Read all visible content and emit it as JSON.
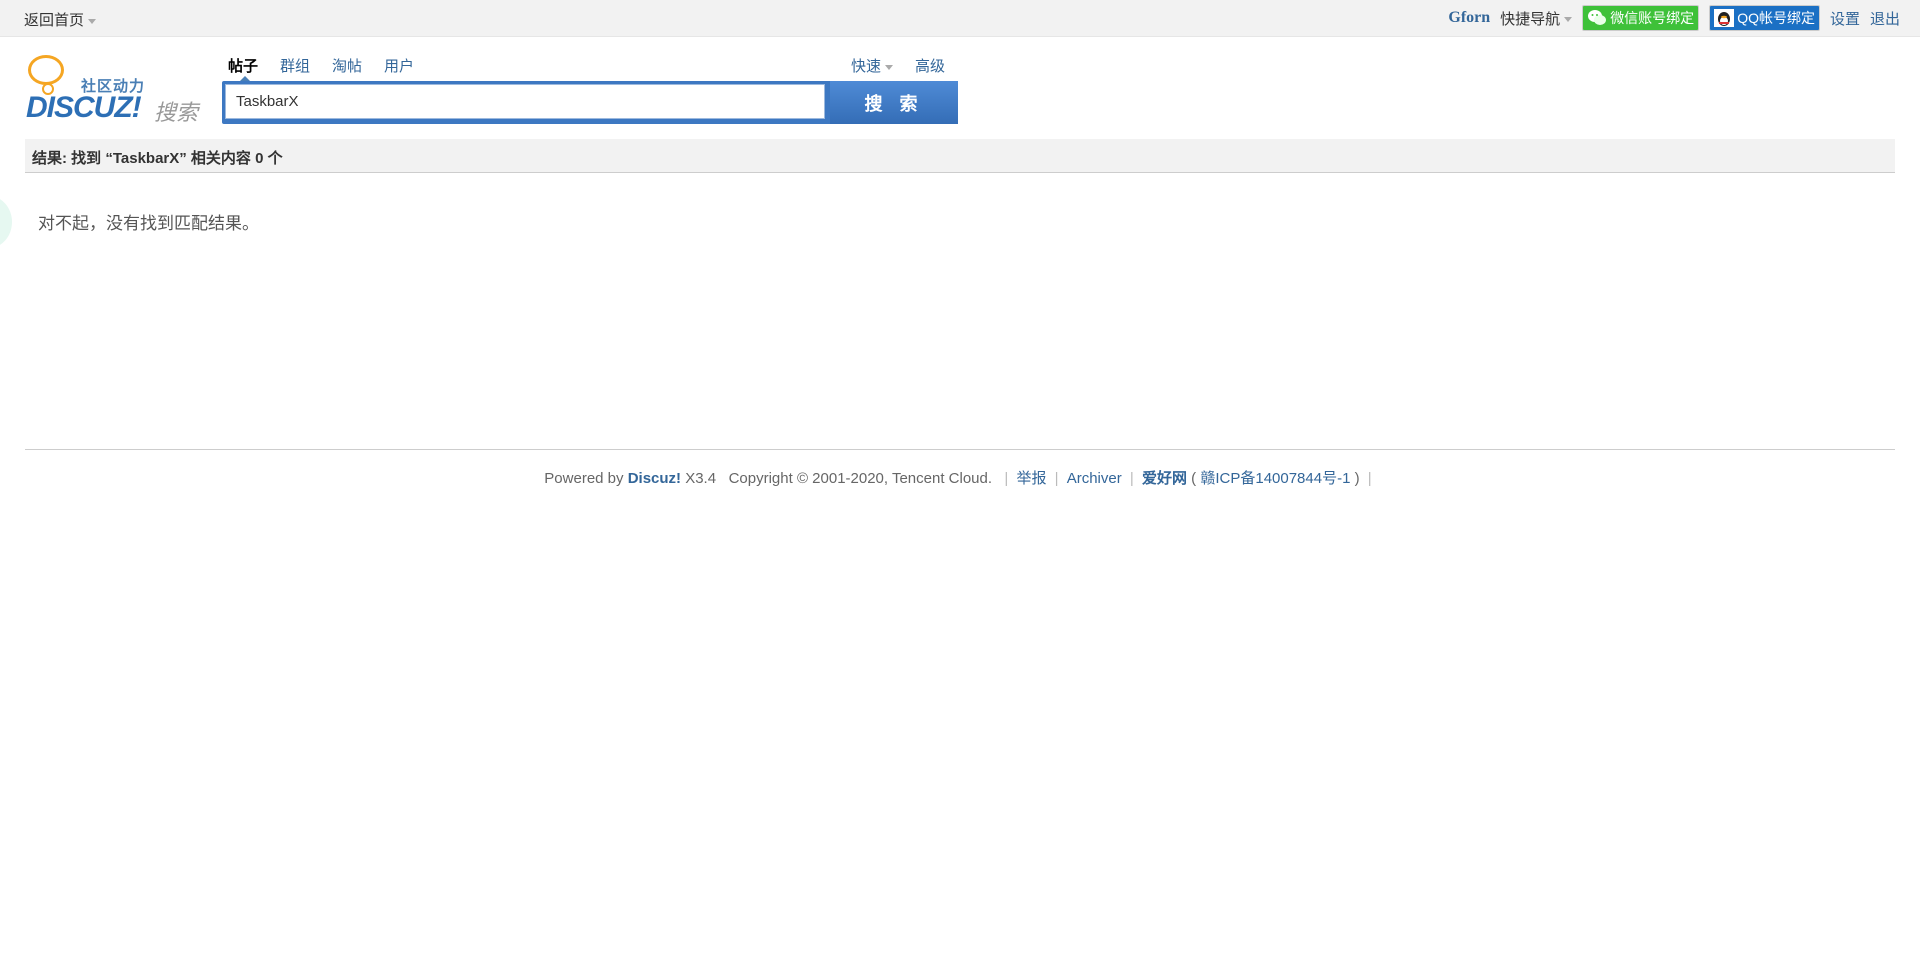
{
  "topbar": {
    "home": "返回首页",
    "username": "Gforn",
    "quick_nav": "快捷导航",
    "wechat_bind": "微信账号绑定",
    "qq_bind": "QQ帐号绑定",
    "settings": "设置",
    "logout": "退出"
  },
  "logo": {
    "slogan": "社区动力",
    "brand": "DISCUZ!",
    "sub": "搜索"
  },
  "search": {
    "tabs": [
      {
        "label": "帖子",
        "active": true
      },
      {
        "label": "群组",
        "active": false
      },
      {
        "label": "淘帖",
        "active": false
      },
      {
        "label": "用户",
        "active": false
      }
    ],
    "quick": "快速",
    "advanced": "高级",
    "query": "TaskbarX",
    "button": "搜 索"
  },
  "results": {
    "summary": "结果: 找到 “TaskbarX” 相关内容 0 个",
    "empty_message": "对不起，没有找到匹配结果。"
  },
  "footer": {
    "powered_by": "Powered by",
    "product": "Discuz!",
    "version": "X3.4",
    "copyright": "Copyright © 2001-2020, Tencent Cloud.",
    "report": "举报",
    "archiver": "Archiver",
    "site_name": "爱好网",
    "icp": "赣ICP备14007844号-1"
  },
  "colors": {
    "link": "#336699",
    "search_button": "#3d78c2",
    "wechat_green": "#3ec139",
    "qq_blue": "#1b70c4"
  }
}
